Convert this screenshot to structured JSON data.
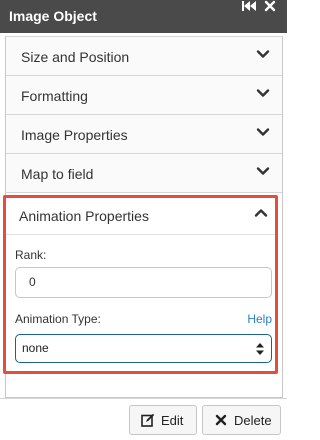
{
  "window": {
    "title": "Image Object"
  },
  "accordion": {
    "items": [
      {
        "label": "Size and Position",
        "icon": "chevron-down-icon"
      },
      {
        "label": "Formatting",
        "icon": "chevron-down-icon"
      },
      {
        "label": "Image Properties",
        "icon": "chevron-down-icon"
      },
      {
        "label": "Map to field",
        "icon": "chevron-down-icon"
      }
    ],
    "open": {
      "label": "Animation Properties",
      "icon": "chevron-up-icon",
      "highlight_color": "#e74c3c",
      "rank_label": "Rank:",
      "rank_value": "0",
      "animation_type_label": "Animation Type:",
      "help_label": "Help",
      "animation_type_value": "none"
    }
  },
  "footer": {
    "edit_label": "Edit",
    "delete_label": "Delete"
  },
  "colors": {
    "titlebar": "#4a4a4a",
    "link": "#2c7dc4",
    "select_border": "#1f5f8b"
  }
}
